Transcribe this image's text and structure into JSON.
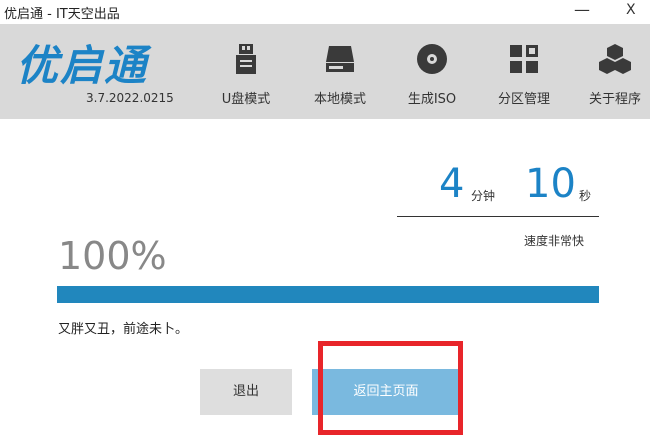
{
  "window": {
    "title": "优启通 - IT天空出品",
    "minimize_label": "—",
    "close_label": "X"
  },
  "header": {
    "logo_text": "优启通",
    "version": "3.7.2022.0215",
    "nav": [
      {
        "label": "U盘模式",
        "icon": "usb-drive-icon"
      },
      {
        "label": "本地模式",
        "icon": "hard-drive-icon"
      },
      {
        "label": "生成ISO",
        "icon": "disc-icon"
      },
      {
        "label": "分区管理",
        "icon": "partition-grid-icon"
      },
      {
        "label": "关于程序",
        "icon": "about-cubes-icon"
      }
    ]
  },
  "timer": {
    "minutes": "4",
    "minutes_unit": "分钟",
    "seconds": "10",
    "seconds_unit": "秒"
  },
  "speed_text": "速度非常快",
  "progress": {
    "percent_text": "100%",
    "value": 1.0,
    "color": "#2187bd"
  },
  "status_text": "又胖又丑，前途未卜。",
  "buttons": {
    "exit": "退出",
    "home": "返回主页面"
  },
  "colors": {
    "accent": "#1c83c6",
    "header_bg": "#d9d9d9",
    "highlight": "#e8252a",
    "home_button": "#7ab9df"
  }
}
